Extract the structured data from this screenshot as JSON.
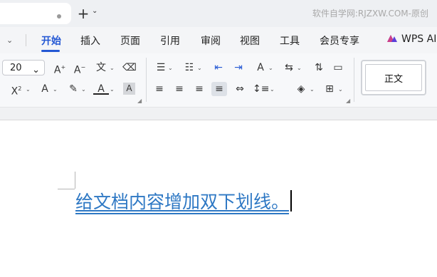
{
  "watermark": "软件自学网:RJZXW.COM-原创",
  "tabbar": {
    "new_tab_symbol": "+"
  },
  "menu": {
    "items": [
      "开始",
      "插入",
      "页面",
      "引用",
      "审阅",
      "视图",
      "工具",
      "会员专享"
    ],
    "active": "开始",
    "ai_label": "WPS AI",
    "accent": "#2458d4"
  },
  "ribbon": {
    "font_size": "20",
    "style_name": "正文",
    "icons": [
      "grow-font",
      "shrink-font",
      "phonetic-guide",
      "clear-format",
      "superscript",
      "text-effect",
      "highlight",
      "font-color",
      "char-shading",
      "bullets",
      "numbering",
      "decrease-indent",
      "increase-indent",
      "char-spacing",
      "text-direction",
      "sort",
      "show-marks",
      "align-left",
      "align-center",
      "align-right",
      "justify",
      "distributed",
      "line-spacing",
      "shading",
      "borders"
    ],
    "shading_char": "A"
  },
  "document": {
    "text": "给文档内容增加双下划线。",
    "text_color": "#2e78c4",
    "underline": "double"
  }
}
